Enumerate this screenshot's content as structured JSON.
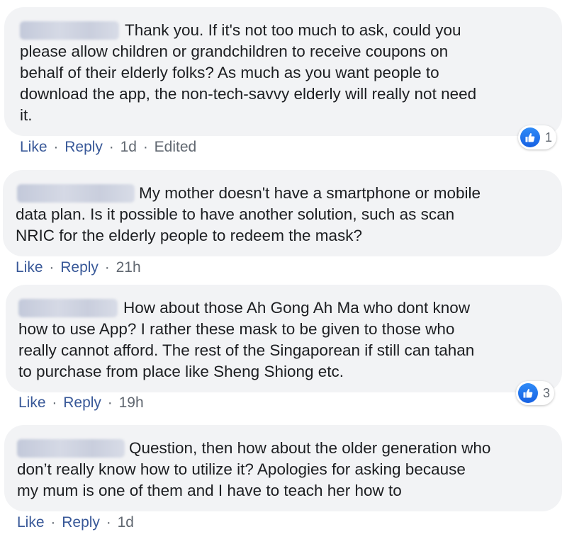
{
  "comments": [
    {
      "lines": [
        "Thank you. If it's not too much to ask, could you",
        "please allow children or grandchildren to receive coupons on",
        "behalf of their elderly folks? As much as you want people to",
        "download the app, the non-tech-savvy elderly will really not need",
        "it."
      ],
      "like_label": "Like",
      "reply_label": "Reply",
      "time": "1d",
      "edited": "Edited",
      "reaction_count": "1"
    },
    {
      "lines": [
        "My mother doesn't have a smartphone or mobile",
        "data plan. Is it possible to have another solution, such as scan",
        "NRIC for the elderly people to redeem the mask?"
      ],
      "like_label": "Like",
      "reply_label": "Reply",
      "time": "21h"
    },
    {
      "lines": [
        "How about those Ah Gong Ah Ma who dont know",
        "how to use App? I rather these mask to be given to those who",
        "really cannot afford. The rest of the Singaporean if still can tahan",
        "to purchase from place like Sheng Shiong etc."
      ],
      "like_label": "Like",
      "reply_label": "Reply",
      "time": "19h",
      "reaction_count": "3"
    },
    {
      "lines": [
        "Question, then how about the older generation who",
        "don’t really know how to utilize it? Apologies for asking because",
        "my mum is one of them and I have to teach her how to"
      ],
      "like_label": "Like",
      "reply_label": "Reply",
      "time": "1d"
    }
  ],
  "separator": "·",
  "icons": {
    "reaction": "thumbs-up-icon",
    "reaction_color": "#1877f2"
  },
  "colors": {
    "bubble": "#f2f3f5",
    "link": "#385898",
    "meta": "#606770",
    "text": "#1c1e21"
  }
}
